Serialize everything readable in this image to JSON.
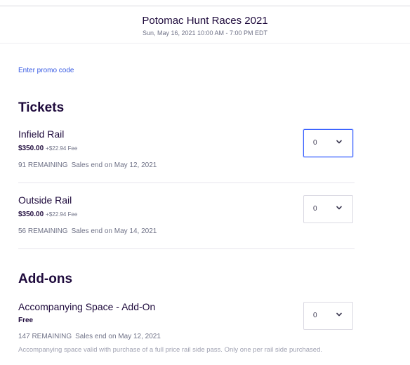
{
  "header": {
    "title": "Potomac Hunt Races 2021",
    "date": "Sun, May 16, 2021 10:00 AM - 7:00 PM EDT"
  },
  "promo_label": "Enter promo code",
  "tickets": {
    "section_title": "Tickets",
    "items": [
      {
        "name": "Infield Rail",
        "price": "$350.00",
        "fee": "+$22.94 Fee",
        "remaining": "91 REMAINING",
        "sales_end": "Sales end on May 12, 2021",
        "quantity": "0"
      },
      {
        "name": "Outside Rail",
        "price": "$350.00",
        "fee": "+$22.94 Fee",
        "remaining": "56 REMAINING",
        "sales_end": "Sales end on May 14, 2021",
        "quantity": "0"
      }
    ]
  },
  "addons": {
    "section_title": "Add-ons",
    "items": [
      {
        "name": "Accompanying Space - Add-On",
        "price": "Free",
        "remaining": "147 REMAINING",
        "sales_end": "Sales end on May 12, 2021",
        "description": "Accompanying space valid with purchase of a full price rail side pass. Only one per rail side purchased.",
        "quantity": "0"
      }
    ]
  },
  "colors": {
    "text_primary": "#1e0a3c",
    "text_secondary": "#6f7287",
    "link": "#3659e3",
    "focus_border": "#3d64ff"
  }
}
